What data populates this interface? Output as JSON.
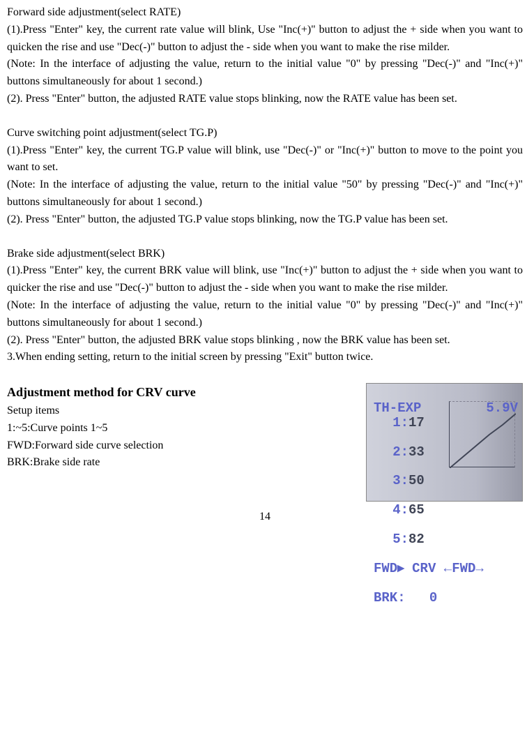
{
  "section_rate": {
    "title": "Forward side adjustment(select RATE)",
    "p1": "(1).Press \"Enter\" key, the current rate value will blink, Use \"Inc(+)\" button to adjust the + side when you want to quicken the rise and use \"Dec(-)\" button to adjust the - side when you want to make the rise milder.",
    "note": "(Note: In the interface of adjusting the value, return to the initial value \"0\" by pressing \"Dec(-)\" and \"Inc(+)\" buttons simultaneously for about 1 second.)",
    "p2": "(2). Press   \"Enter\" button, the adjusted RATE value stops blinking, now the RATE value has been set."
  },
  "section_tgp": {
    "title": "Curve switching point adjustment(select TG.P)",
    "p1": "(1).Press \"Enter\" key, the current TG.P value will blink, use \"Dec(-)\" or \"Inc(+)\" button to move to the point you want to set.",
    "note": "(Note: In the interface of adjusting the value, return to the initial value \"50\" by pressing \"Dec(-)\" and \"Inc(+)\" buttons simultaneously for about 1 second.)",
    "p2": "(2). Press \"Enter\" button, the adjusted TG.P value stops blinking, now the TG.P value has been set."
  },
  "section_brk": {
    "title": "Brake side adjustment(select BRK)",
    "p1": "(1).Press \"Enter\" key, the current BRK value will blink, use  \"Inc(+)\" button to adjust the + side when you want to quicker the rise and use \"Dec(-)\" button to adjust the - side when you want to make the rise milder.",
    "note": "(Note: In the interface of adjusting the value, return to the initial value \"0\" by pressing \"Dec(-)\" and \"Inc(+)\" buttons simultaneously for about 1 second.)",
    "p2": "(2). Press   \"Enter\" button, the adjusted BRK value stops blinking , now the BRK value has been set.",
    "p3": "3.When ending setting, return to the initial screen by pressing \"Exit\" button twice."
  },
  "section_crv": {
    "heading": "Adjustment method for CRV curve",
    "l1": "Setup items",
    "l2": "1:~5:Curve points 1~5",
    "l3": "FWD:Forward side curve selection",
    "l4": "BRK:Brake side rate"
  },
  "lcd": {
    "title": "TH-EXP",
    "voltage": "5.9V",
    "rows": [
      {
        "n": "1:",
        "v": "17"
      },
      {
        "n": "2:",
        "v": "33"
      },
      {
        "n": "3:",
        "v": "50"
      },
      {
        "n": "4:",
        "v": "65"
      },
      {
        "n": "5:",
        "v": "82"
      }
    ],
    "footer1_left": "FWD▸",
    "footer1_mid": "CRV",
    "footer1_right_pre": "←",
    "footer1_right": "FWD",
    "footer1_right_post": "→",
    "footer2_left": "BRK:",
    "footer2_val": "0"
  },
  "page_number": "14"
}
